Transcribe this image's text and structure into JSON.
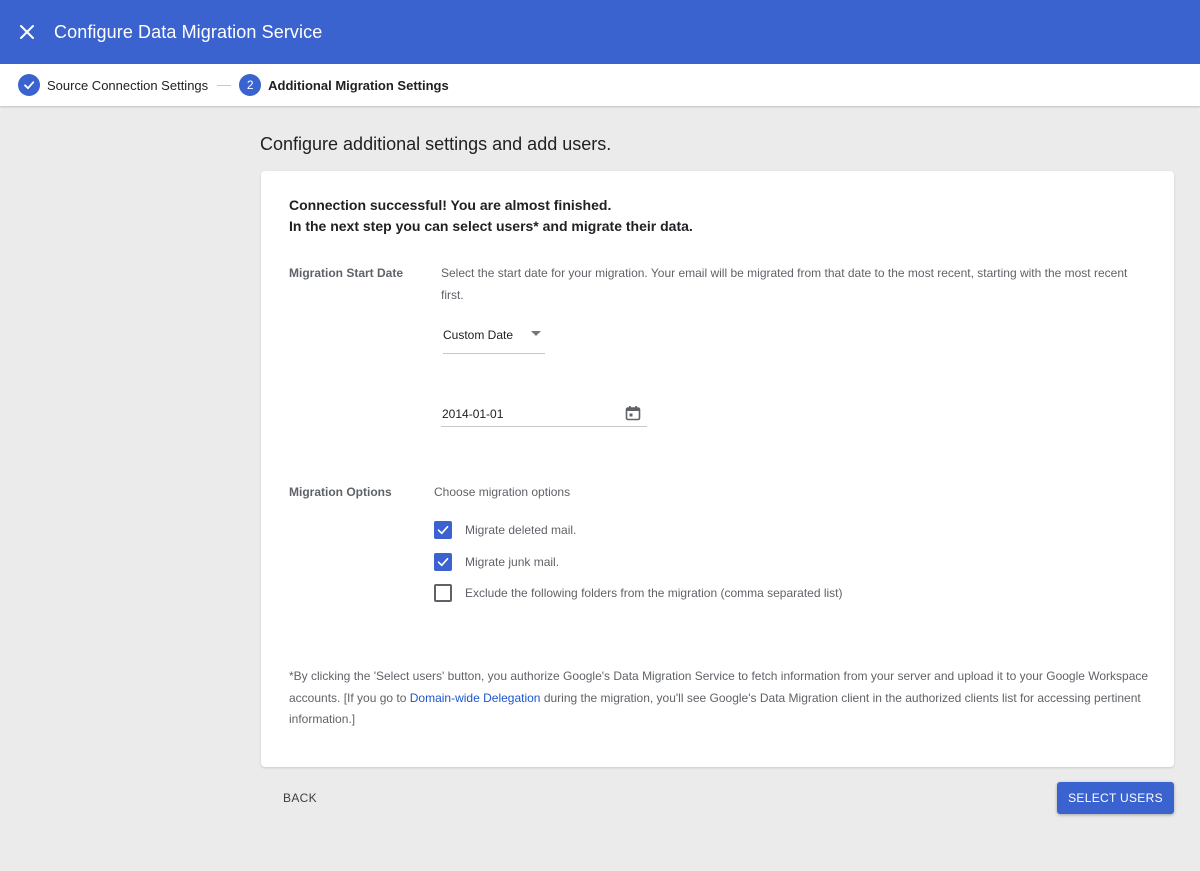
{
  "header": {
    "title": "Configure Data Migration Service",
    "close_icon": "close-icon",
    "background_color": "#3a63cf"
  },
  "stepper": {
    "steps": [
      {
        "label": "Source Connection Settings",
        "state": "completed",
        "icon": "check-icon"
      },
      {
        "number": "2",
        "label": "Additional Migration Settings",
        "state": "active"
      }
    ]
  },
  "page": {
    "heading": "Configure additional settings and add users."
  },
  "card": {
    "success_line1": "Connection successful! You are almost finished.",
    "success_line2": "In the next step you can select users* and migrate their data.",
    "start_date": {
      "label": "Migration Start Date",
      "description": "Select the start date for your migration. Your email will be migrated from that date to the most recent, starting with the most recent first.",
      "select_value": "Custom Date",
      "date_value": "2014-01-01",
      "calendar_icon": "calendar-icon"
    },
    "options": {
      "label": "Migration Options",
      "description": "Choose migration options",
      "items": [
        {
          "label": "Migrate deleted mail.",
          "checked": true
        },
        {
          "label": "Migrate junk mail.",
          "checked": true
        },
        {
          "label": "Exclude the following folders from the migration (comma separated list)",
          "checked": false
        }
      ]
    },
    "footnote": {
      "before_link": "*By clicking the 'Select users' button, you authorize Google's Data Migration Service to fetch information from your server and upload it to your Google Workspace accounts. [If you go to ",
      "link": "Domain-wide Delegation",
      "after_link": " during the migration, you'll see Google's Data Migration client in the authorized clients list for accessing pertinent information.]"
    }
  },
  "actions": {
    "back_label": "BACK",
    "primary_label": "SELECT USERS",
    "primary_color": "#3a63cf"
  }
}
